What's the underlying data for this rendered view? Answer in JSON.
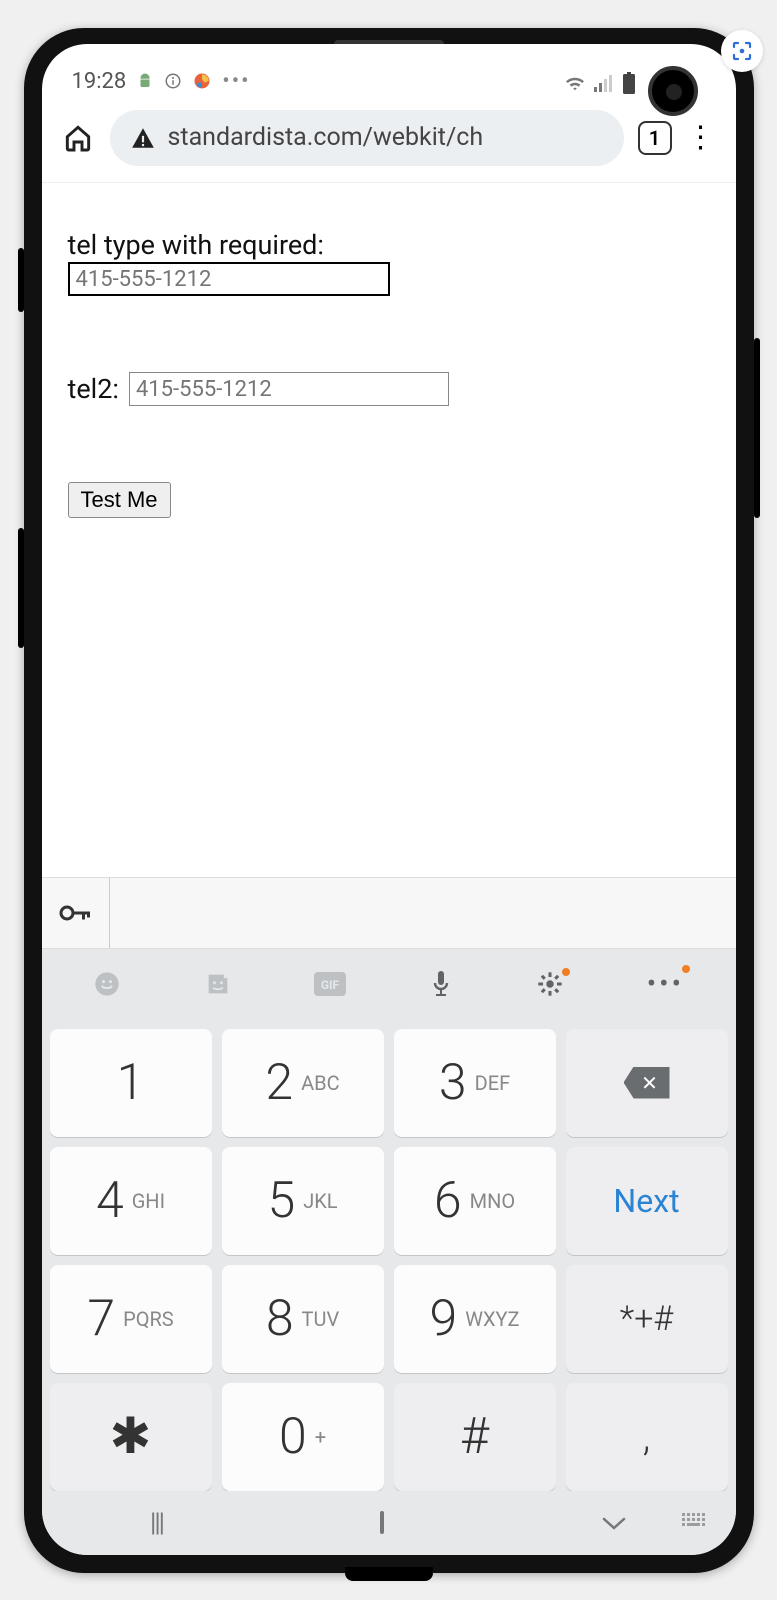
{
  "status": {
    "time": "19:28"
  },
  "browser": {
    "url": "standardista.com/webkit/ch",
    "tab_count": "1"
  },
  "form": {
    "label1": "tel type with required:",
    "input1_placeholder": "415-555-1212",
    "label2": "tel2:",
    "input2_placeholder": "415-555-1212",
    "button": "Test Me"
  },
  "keypad": {
    "rows": [
      [
        {
          "d": "1",
          "l": ""
        },
        {
          "d": "2",
          "l": "ABC"
        },
        {
          "d": "3",
          "l": "DEF"
        },
        {
          "type": "backspace"
        }
      ],
      [
        {
          "d": "4",
          "l": "GHI"
        },
        {
          "d": "5",
          "l": "JKL"
        },
        {
          "d": "6",
          "l": "MNO"
        },
        {
          "type": "next",
          "label": "Next"
        }
      ],
      [
        {
          "d": "7",
          "l": "PQRS"
        },
        {
          "d": "8",
          "l": "TUV"
        },
        {
          "d": "9",
          "l": "WXYZ"
        },
        {
          "d": "*+#",
          "l": "",
          "alt": true
        }
      ],
      [
        {
          "d": "✱",
          "l": "",
          "alt": true
        },
        {
          "d": "0",
          "l": "+"
        },
        {
          "d": "#",
          "l": "",
          "alt": true
        },
        {
          "d": ",",
          "l": "",
          "alt": true
        }
      ]
    ],
    "next_label": "Next"
  }
}
